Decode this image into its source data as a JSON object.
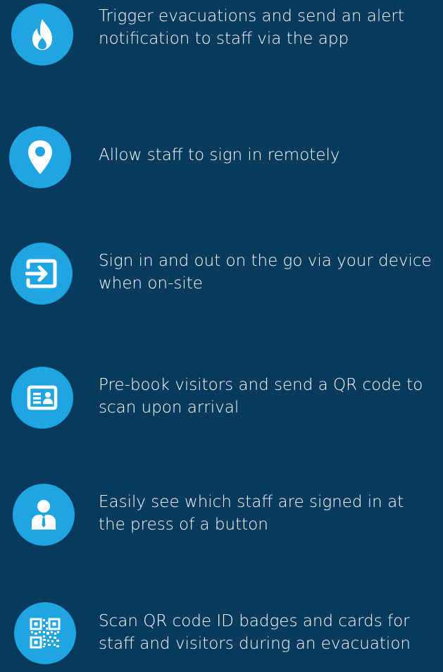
{
  "features": [
    {
      "icon": "fire-icon",
      "line1": "Trigger evacuations and send an alert",
      "line2": "notification to staff via the app"
    },
    {
      "icon": "location-pin-icon",
      "line1": "Allow staff to sign in remotely",
      "line2": ""
    },
    {
      "icon": "sign-in-icon",
      "line1": "Sign in and out on the go via your device",
      "line2": "when on-site"
    },
    {
      "icon": "id-card-icon",
      "line1": "Pre-book visitors and send a QR code to",
      "line2": "scan upon arrival"
    },
    {
      "icon": "staff-person-icon",
      "line1": "Easily see which staff are signed in at",
      "line2": "the press of a button"
    },
    {
      "icon": "qr-code-icon",
      "line1": "Scan QR code ID badges and cards for",
      "line2": "staff and visitors during an evacuation"
    }
  ],
  "colors": {
    "background": "#073a5c",
    "accent": "#1fa6e2",
    "text": "#ffffff"
  }
}
